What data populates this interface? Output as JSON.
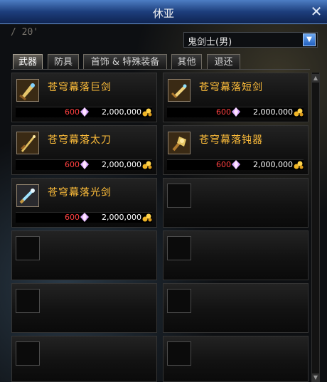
{
  "window": {
    "title": "休亚"
  },
  "hint": "/ 20'",
  "class_select": {
    "value": "鬼剑士(男)"
  },
  "tabs": [
    {
      "label": "武器",
      "active": true
    },
    {
      "label": "防具",
      "active": false
    },
    {
      "label": "首饰 & 特殊装备",
      "active": false
    },
    {
      "label": "其他",
      "active": false
    },
    {
      "label": "退还",
      "active": false
    }
  ],
  "items": [
    {
      "name": "苍穹幕落巨剑",
      "quantity": "600",
      "price": "2,000,000",
      "icon": "greatsword-icon"
    },
    {
      "name": "苍穹幕落短剑",
      "quantity": "600",
      "price": "2,000,000",
      "icon": "shortsword-icon"
    },
    {
      "name": "苍穹幕落太刀",
      "quantity": "600",
      "price": "2,000,000",
      "icon": "katana-icon"
    },
    {
      "name": "苍穹幕落钝器",
      "quantity": "600",
      "price": "2,000,000",
      "icon": "blunt-weapon-icon"
    },
    {
      "name": "苍穹幕落光剑",
      "quantity": "600",
      "price": "2,000,000",
      "icon": "lightsaber-icon"
    }
  ],
  "colors": {
    "accent": "#ffbe3a",
    "quantity": "#ff4040",
    "title_bar": "#1d3e7c"
  }
}
